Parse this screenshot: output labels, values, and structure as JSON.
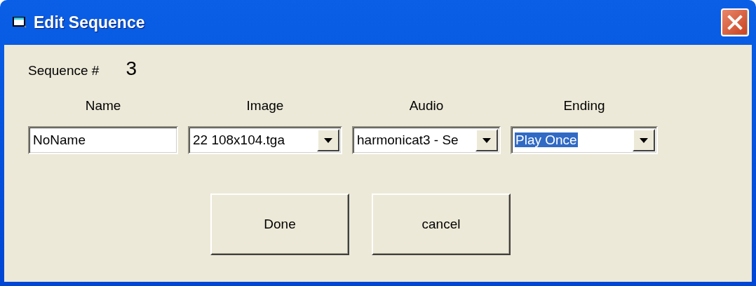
{
  "window": {
    "title": "Edit Sequence"
  },
  "sequence": {
    "label": "Sequence #",
    "value": "3"
  },
  "fields": [
    {
      "kind": "text",
      "label": "Name",
      "value": "NoName",
      "highlighted": false
    },
    {
      "kind": "combo",
      "label": "Image",
      "value": "22 108x104.tga",
      "highlighted": false
    },
    {
      "kind": "combo",
      "label": "Audio",
      "value": "harmonicat3 - Se",
      "highlighted": false
    },
    {
      "kind": "combo",
      "label": "Ending",
      "value": "Play Once",
      "highlighted": true
    }
  ],
  "buttons": [
    "Done",
    "cancel"
  ]
}
